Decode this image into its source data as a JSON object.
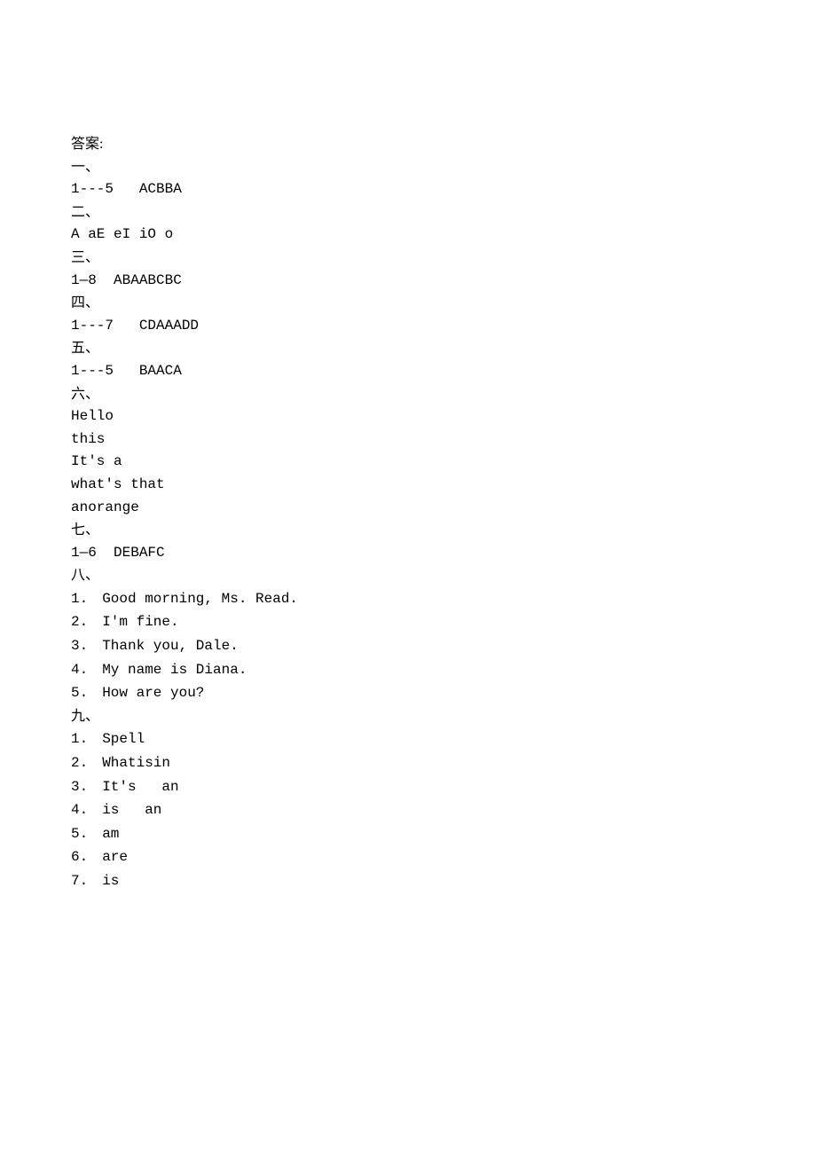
{
  "title": "答案:",
  "sections": {
    "s1": {
      "heading": "一、",
      "line": "1---5   ACBBA"
    },
    "s2": {
      "heading": "二、",
      "line": "A aE eI iO o"
    },
    "s3": {
      "heading": "三、",
      "line": "1—8  ABAABCBC"
    },
    "s4": {
      "heading": "四、",
      "line": "1---7   CDAAADD"
    },
    "s5": {
      "heading": "五、",
      "line": "1---5   BAACA"
    },
    "s6": {
      "heading": "六、",
      "lines": [
        "Hello",
        "this",
        "It's a",
        "what's that",
        "anorange"
      ]
    },
    "s7": {
      "heading": "七、",
      "line": "1—6  DEBAFC"
    },
    "s8": {
      "heading": "八、",
      "items": [
        "Good morning, Ms. Read.",
        "I'm fine.",
        "Thank you, Dale.",
        "My name is Diana.",
        "How are you?"
      ]
    },
    "s9": {
      "heading": "九、",
      "items": [
        "Spell",
        "Whatisin",
        "It's   an",
        "is   an",
        "am",
        "are",
        "is"
      ]
    }
  }
}
